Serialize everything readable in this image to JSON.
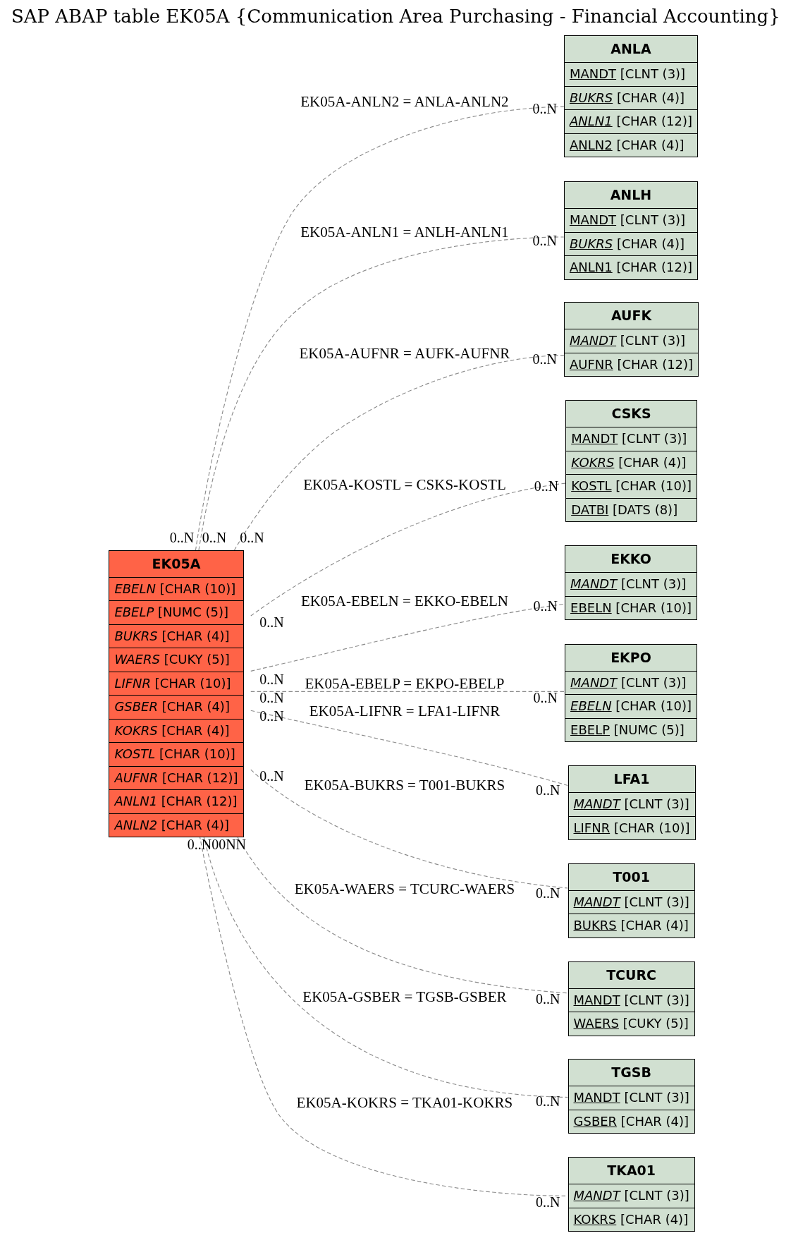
{
  "title": "SAP ABAP table EK05A {Communication Area Purchasing - Financial Accounting}",
  "tables": [
    {
      "name": "EK05A",
      "kind": "main",
      "fields": [
        {
          "name": "EBELN",
          "type": "[CHAR (10)]",
          "key": false,
          "foreign": true
        },
        {
          "name": "EBELP",
          "type": "[NUMC (5)]",
          "key": false,
          "foreign": true
        },
        {
          "name": "BUKRS",
          "type": "[CHAR (4)]",
          "key": false,
          "foreign": true
        },
        {
          "name": "WAERS",
          "type": "[CUKY (5)]",
          "key": false,
          "foreign": true
        },
        {
          "name": "LIFNR",
          "type": "[CHAR (10)]",
          "key": false,
          "foreign": true
        },
        {
          "name": "GSBER",
          "type": "[CHAR (4)]",
          "key": false,
          "foreign": true
        },
        {
          "name": "KOKRS",
          "type": "[CHAR (4)]",
          "key": false,
          "foreign": true
        },
        {
          "name": "KOSTL",
          "type": "[CHAR (10)]",
          "key": false,
          "foreign": true
        },
        {
          "name": "AUFNR",
          "type": "[CHAR (12)]",
          "key": false,
          "foreign": true
        },
        {
          "name": "ANLN1",
          "type": "[CHAR (12)]",
          "key": false,
          "foreign": true
        },
        {
          "name": "ANLN2",
          "type": "[CHAR (4)]",
          "key": false,
          "foreign": true
        }
      ]
    },
    {
      "name": "ANLA",
      "kind": "related",
      "fields": [
        {
          "name": "MANDT",
          "type": "[CLNT (3)]",
          "key": true,
          "foreign": false
        },
        {
          "name": "BUKRS",
          "type": "[CHAR (4)]",
          "key": true,
          "foreign": true
        },
        {
          "name": "ANLN1",
          "type": "[CHAR (12)]",
          "key": true,
          "foreign": true
        },
        {
          "name": "ANLN2",
          "type": "[CHAR (4)]",
          "key": true,
          "foreign": false
        }
      ]
    },
    {
      "name": "ANLH",
      "kind": "related",
      "fields": [
        {
          "name": "MANDT",
          "type": "[CLNT (3)]",
          "key": true,
          "foreign": false
        },
        {
          "name": "BUKRS",
          "type": "[CHAR (4)]",
          "key": true,
          "foreign": true
        },
        {
          "name": "ANLN1",
          "type": "[CHAR (12)]",
          "key": true,
          "foreign": false
        }
      ]
    },
    {
      "name": "AUFK",
      "kind": "related",
      "fields": [
        {
          "name": "MANDT",
          "type": "[CLNT (3)]",
          "key": true,
          "foreign": true
        },
        {
          "name": "AUFNR",
          "type": "[CHAR (12)]",
          "key": true,
          "foreign": false
        }
      ]
    },
    {
      "name": "CSKS",
      "kind": "related",
      "fields": [
        {
          "name": "MANDT",
          "type": "[CLNT (3)]",
          "key": true,
          "foreign": false
        },
        {
          "name": "KOKRS",
          "type": "[CHAR (4)]",
          "key": true,
          "foreign": true
        },
        {
          "name": "KOSTL",
          "type": "[CHAR (10)]",
          "key": true,
          "foreign": false
        },
        {
          "name": "DATBI",
          "type": "[DATS (8)]",
          "key": true,
          "foreign": false
        }
      ]
    },
    {
      "name": "EKKO",
      "kind": "related",
      "fields": [
        {
          "name": "MANDT",
          "type": "[CLNT (3)]",
          "key": true,
          "foreign": true
        },
        {
          "name": "EBELN",
          "type": "[CHAR (10)]",
          "key": true,
          "foreign": false
        }
      ]
    },
    {
      "name": "EKPO",
      "kind": "related",
      "fields": [
        {
          "name": "MANDT",
          "type": "[CLNT (3)]",
          "key": true,
          "foreign": true
        },
        {
          "name": "EBELN",
          "type": "[CHAR (10)]",
          "key": true,
          "foreign": true
        },
        {
          "name": "EBELP",
          "type": "[NUMC (5)]",
          "key": true,
          "foreign": false
        }
      ]
    },
    {
      "name": "LFA1",
      "kind": "related",
      "fields": [
        {
          "name": "MANDT",
          "type": "[CLNT (3)]",
          "key": true,
          "foreign": true
        },
        {
          "name": "LIFNR",
          "type": "[CHAR (10)]",
          "key": true,
          "foreign": false
        }
      ]
    },
    {
      "name": "T001",
      "kind": "related",
      "fields": [
        {
          "name": "MANDT",
          "type": "[CLNT (3)]",
          "key": true,
          "foreign": true
        },
        {
          "name": "BUKRS",
          "type": "[CHAR (4)]",
          "key": true,
          "foreign": false
        }
      ]
    },
    {
      "name": "TCURC",
      "kind": "related",
      "fields": [
        {
          "name": "MANDT",
          "type": "[CLNT (3)]",
          "key": true,
          "foreign": false
        },
        {
          "name": "WAERS",
          "type": "[CUKY (5)]",
          "key": true,
          "foreign": false
        }
      ]
    },
    {
      "name": "TGSB",
      "kind": "related",
      "fields": [
        {
          "name": "MANDT",
          "type": "[CLNT (3)]",
          "key": true,
          "foreign": false
        },
        {
          "name": "GSBER",
          "type": "[CHAR (4)]",
          "key": true,
          "foreign": false
        }
      ]
    },
    {
      "name": "TKA01",
      "kind": "related",
      "fields": [
        {
          "name": "MANDT",
          "type": "[CLNT (3)]",
          "key": true,
          "foreign": true
        },
        {
          "name": "KOKRS",
          "type": "[CHAR (4)]",
          "key": true,
          "foreign": false
        }
      ]
    }
  ],
  "relations": [
    {
      "label": "EK05A-ANLN2 = ANLA-ANLN2",
      "source_cardinality": "0..N",
      "target_cardinality": "0..N"
    },
    {
      "label": "EK05A-ANLN1 = ANLH-ANLN1",
      "source_cardinality": "0..N",
      "target_cardinality": "0..N"
    },
    {
      "label": "EK05A-AUFNR = AUFK-AUFNR",
      "source_cardinality": "0..N",
      "target_cardinality": "0..N"
    },
    {
      "label": "EK05A-KOSTL = CSKS-KOSTL",
      "source_cardinality": "0..N",
      "target_cardinality": "0..N"
    },
    {
      "label": "EK05A-EBELN = EKKO-EBELN",
      "source_cardinality": "0..N",
      "target_cardinality": "0..N"
    },
    {
      "label": "EK05A-EBELP = EKPO-EBELP",
      "source_cardinality": "0..N",
      "target_cardinality": "0..N"
    },
    {
      "label": "EK05A-LIFNR = LFA1-LIFNR",
      "source_cardinality": "0..N",
      "target_cardinality": "0..N"
    },
    {
      "label": "EK05A-BUKRS = T001-BUKRS",
      "source_cardinality": "0..N",
      "target_cardinality": "0..N"
    },
    {
      "label": "EK05A-WAERS = TCURC-WAERS",
      "target_cardinality": "0..N"
    },
    {
      "label": "EK05A-GSBER = TGSB-GSBER",
      "target_cardinality": "0..N"
    },
    {
      "label": "EK05A-KOKRS = TKA01-KOKRS",
      "target_cardinality": "0..N"
    }
  ],
  "overlapping_source_cardinalities": "0..N00NN"
}
